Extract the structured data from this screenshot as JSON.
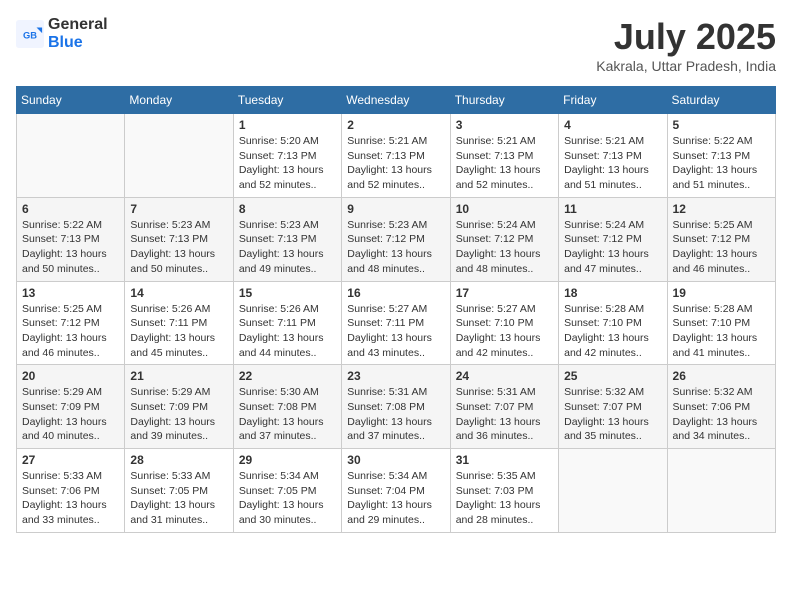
{
  "header": {
    "logo_general": "General",
    "logo_blue": "Blue",
    "month_title": "July 2025",
    "location": "Kakrala, Uttar Pradesh, India"
  },
  "weekdays": [
    "Sunday",
    "Monday",
    "Tuesday",
    "Wednesday",
    "Thursday",
    "Friday",
    "Saturday"
  ],
  "weeks": [
    [
      {
        "day": null
      },
      {
        "day": null
      },
      {
        "day": "1",
        "sunrise": "5:20 AM",
        "sunset": "7:13 PM",
        "daylight": "13 hours and 52 minutes."
      },
      {
        "day": "2",
        "sunrise": "5:21 AM",
        "sunset": "7:13 PM",
        "daylight": "13 hours and 52 minutes."
      },
      {
        "day": "3",
        "sunrise": "5:21 AM",
        "sunset": "7:13 PM",
        "daylight": "13 hours and 52 minutes."
      },
      {
        "day": "4",
        "sunrise": "5:21 AM",
        "sunset": "7:13 PM",
        "daylight": "13 hours and 51 minutes."
      },
      {
        "day": "5",
        "sunrise": "5:22 AM",
        "sunset": "7:13 PM",
        "daylight": "13 hours and 51 minutes."
      }
    ],
    [
      {
        "day": "6",
        "sunrise": "5:22 AM",
        "sunset": "7:13 PM",
        "daylight": "13 hours and 50 minutes."
      },
      {
        "day": "7",
        "sunrise": "5:23 AM",
        "sunset": "7:13 PM",
        "daylight": "13 hours and 50 minutes."
      },
      {
        "day": "8",
        "sunrise": "5:23 AM",
        "sunset": "7:13 PM",
        "daylight": "13 hours and 49 minutes."
      },
      {
        "day": "9",
        "sunrise": "5:23 AM",
        "sunset": "7:12 PM",
        "daylight": "13 hours and 48 minutes."
      },
      {
        "day": "10",
        "sunrise": "5:24 AM",
        "sunset": "7:12 PM",
        "daylight": "13 hours and 48 minutes."
      },
      {
        "day": "11",
        "sunrise": "5:24 AM",
        "sunset": "7:12 PM",
        "daylight": "13 hours and 47 minutes."
      },
      {
        "day": "12",
        "sunrise": "5:25 AM",
        "sunset": "7:12 PM",
        "daylight": "13 hours and 46 minutes."
      }
    ],
    [
      {
        "day": "13",
        "sunrise": "5:25 AM",
        "sunset": "7:12 PM",
        "daylight": "13 hours and 46 minutes."
      },
      {
        "day": "14",
        "sunrise": "5:26 AM",
        "sunset": "7:11 PM",
        "daylight": "13 hours and 45 minutes."
      },
      {
        "day": "15",
        "sunrise": "5:26 AM",
        "sunset": "7:11 PM",
        "daylight": "13 hours and 44 minutes."
      },
      {
        "day": "16",
        "sunrise": "5:27 AM",
        "sunset": "7:11 PM",
        "daylight": "13 hours and 43 minutes."
      },
      {
        "day": "17",
        "sunrise": "5:27 AM",
        "sunset": "7:10 PM",
        "daylight": "13 hours and 42 minutes."
      },
      {
        "day": "18",
        "sunrise": "5:28 AM",
        "sunset": "7:10 PM",
        "daylight": "13 hours and 42 minutes."
      },
      {
        "day": "19",
        "sunrise": "5:28 AM",
        "sunset": "7:10 PM",
        "daylight": "13 hours and 41 minutes."
      }
    ],
    [
      {
        "day": "20",
        "sunrise": "5:29 AM",
        "sunset": "7:09 PM",
        "daylight": "13 hours and 40 minutes."
      },
      {
        "day": "21",
        "sunrise": "5:29 AM",
        "sunset": "7:09 PM",
        "daylight": "13 hours and 39 minutes."
      },
      {
        "day": "22",
        "sunrise": "5:30 AM",
        "sunset": "7:08 PM",
        "daylight": "13 hours and 37 minutes."
      },
      {
        "day": "23",
        "sunrise": "5:31 AM",
        "sunset": "7:08 PM",
        "daylight": "13 hours and 37 minutes."
      },
      {
        "day": "24",
        "sunrise": "5:31 AM",
        "sunset": "7:07 PM",
        "daylight": "13 hours and 36 minutes."
      },
      {
        "day": "25",
        "sunrise": "5:32 AM",
        "sunset": "7:07 PM",
        "daylight": "13 hours and 35 minutes."
      },
      {
        "day": "26",
        "sunrise": "5:32 AM",
        "sunset": "7:06 PM",
        "daylight": "13 hours and 34 minutes."
      }
    ],
    [
      {
        "day": "27",
        "sunrise": "5:33 AM",
        "sunset": "7:06 PM",
        "daylight": "13 hours and 33 minutes."
      },
      {
        "day": "28",
        "sunrise": "5:33 AM",
        "sunset": "7:05 PM",
        "daylight": "13 hours and 31 minutes."
      },
      {
        "day": "29",
        "sunrise": "5:34 AM",
        "sunset": "7:05 PM",
        "daylight": "13 hours and 30 minutes."
      },
      {
        "day": "30",
        "sunrise": "5:34 AM",
        "sunset": "7:04 PM",
        "daylight": "13 hours and 29 minutes."
      },
      {
        "day": "31",
        "sunrise": "5:35 AM",
        "sunset": "7:03 PM",
        "daylight": "13 hours and 28 minutes."
      },
      {
        "day": null
      },
      {
        "day": null
      }
    ]
  ],
  "labels": {
    "sunrise": "Sunrise:",
    "sunset": "Sunset:",
    "daylight": "Daylight:"
  }
}
